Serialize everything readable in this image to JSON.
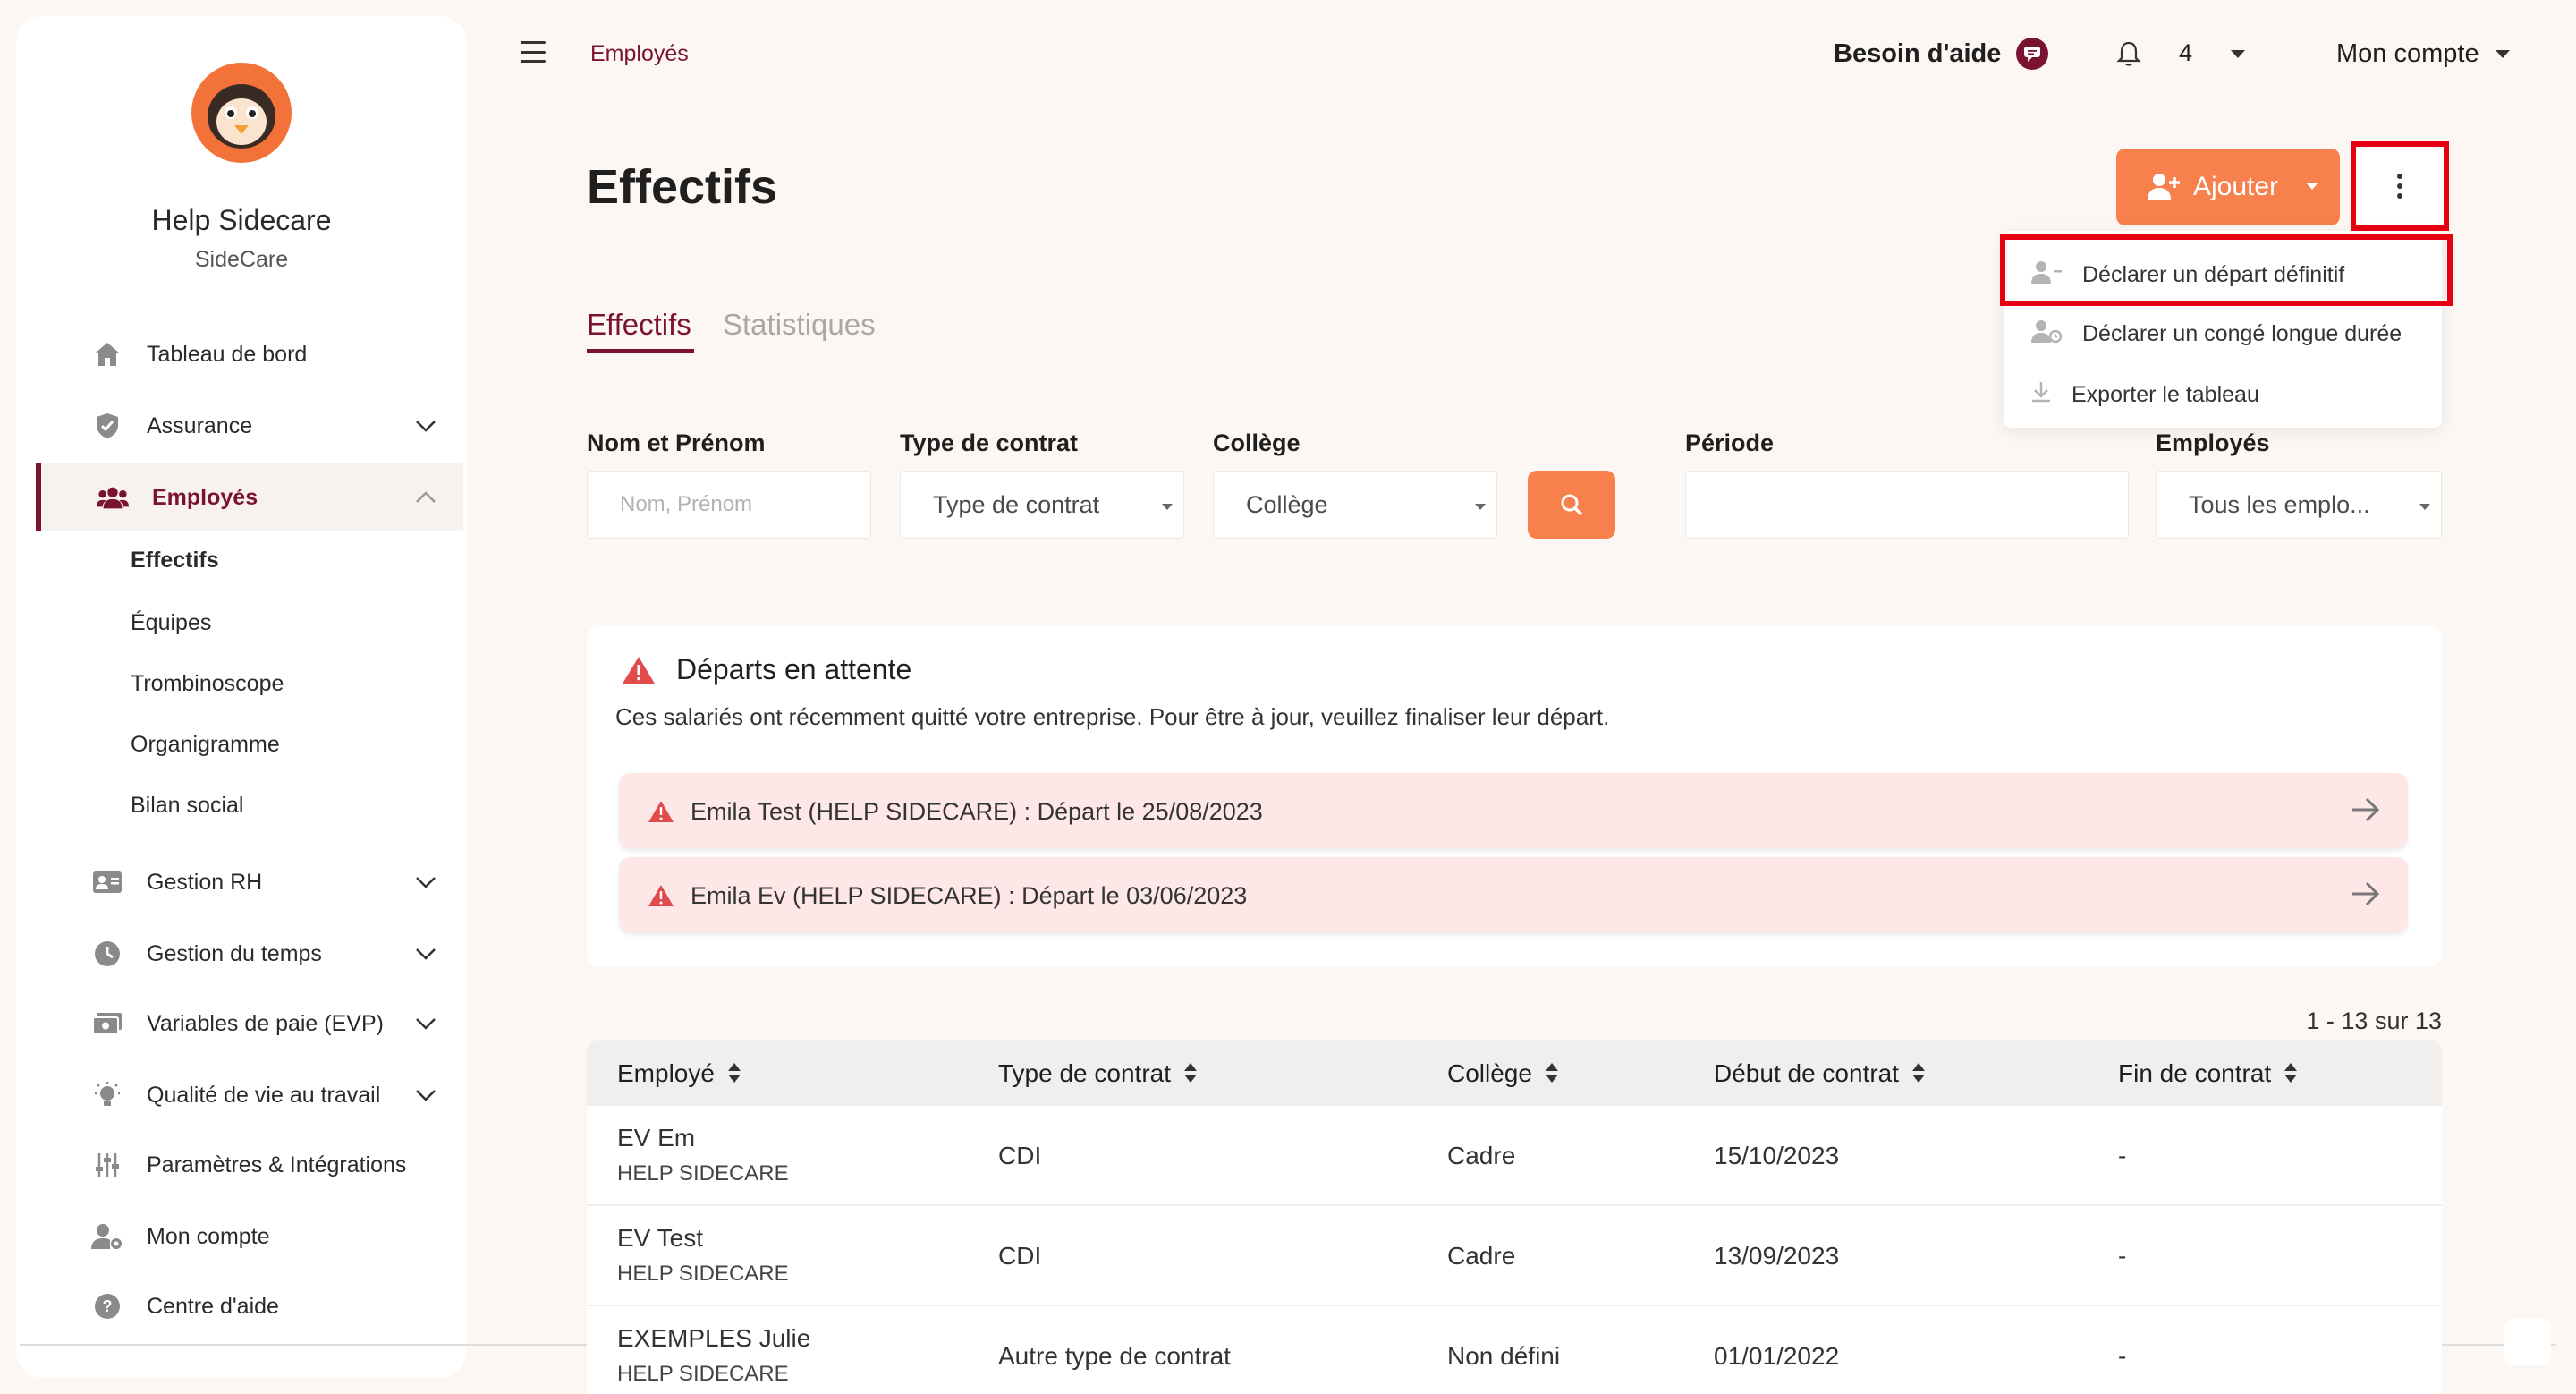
{
  "sidebar": {
    "org_name": "Help Sidecare",
    "org_sub": "SideCare",
    "items": [
      {
        "label": "Tableau de bord",
        "icon": "home-icon"
      },
      {
        "label": "Assurance",
        "icon": "shield-icon"
      },
      {
        "label": "Employés",
        "icon": "users-icon"
      },
      {
        "label": "Gestion RH",
        "icon": "id-card-icon"
      },
      {
        "label": "Gestion du temps",
        "icon": "clock-icon"
      },
      {
        "label": "Variables de paie (EVP)",
        "icon": "money-icon"
      },
      {
        "label": "Qualité de vie au travail",
        "icon": "lightbulb-icon"
      },
      {
        "label": "Paramètres & Intégrations",
        "icon": "sliders-icon"
      },
      {
        "label": "Mon compte",
        "icon": "user-gear-icon"
      },
      {
        "label": "Centre d'aide",
        "icon": "question-icon"
      }
    ],
    "sub_items": [
      "Effectifs",
      "Équipes",
      "Trombinoscope",
      "Organigramme",
      "Bilan social"
    ]
  },
  "topbar": {
    "breadcrumb": "Employés",
    "help_label": "Besoin d'aide",
    "notif_count": "4",
    "account_label": "Mon compte"
  },
  "header": {
    "title": "Effectifs",
    "add_label": "Ajouter"
  },
  "menu": {
    "items": [
      "Déclarer un départ définitif",
      "Déclarer un congé longue durée",
      "Exporter le tableau"
    ]
  },
  "tabs": [
    "Effectifs",
    "Statistiques"
  ],
  "filters": {
    "name_label": "Nom et Prénom",
    "name_placeholder": "Nom, Prénom",
    "contract_label": "Type de contrat",
    "contract_value": "Type de contrat",
    "college_label": "Collège",
    "college_value": "Collège",
    "period_label": "Période",
    "period_value": "",
    "employees_label": "Employés",
    "employees_value": "Tous les emplo..."
  },
  "departures": {
    "title": "Départs en attente",
    "description": "Ces salariés ont récemment quitté votre entreprise. Pour être à jour, veuillez finaliser leur départ.",
    "rows": [
      "Emila Test (HELP SIDECARE) : Départ le 25/08/2023",
      "Emila Ev (HELP SIDECARE) : Départ le 03/06/2023"
    ]
  },
  "table": {
    "count": "1 - 13 sur 13",
    "headers": [
      "Employé",
      "Type de contrat",
      "Collège",
      "Début de contrat",
      "Fin de contrat"
    ],
    "rows": [
      {
        "name": "EV Em",
        "company": "HELP SIDECARE",
        "contract": "CDI",
        "college": "Cadre",
        "start": "15/10/2023",
        "end": "-"
      },
      {
        "name": "EV Test",
        "company": "HELP SIDECARE",
        "contract": "CDI",
        "college": "Cadre",
        "start": "13/09/2023",
        "end": "-"
      },
      {
        "name": "EXEMPLES Julie",
        "company": "HELP SIDECARE",
        "contract": "Autre type de contrat",
        "college": "Non défini",
        "start": "01/01/2022",
        "end": "-"
      }
    ]
  },
  "colors": {
    "accent": "#7a1232",
    "orange": "#f7804c",
    "highlight": "#e60012",
    "warning": "#e24b4b",
    "background": "#fdf7f3"
  }
}
